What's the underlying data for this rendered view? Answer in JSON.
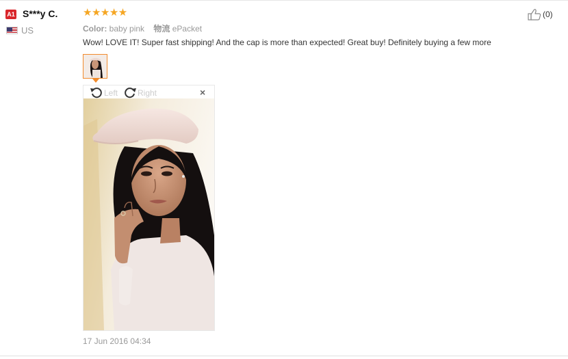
{
  "reviewer": {
    "badge": "A1",
    "name": "S***y C.",
    "country": "US",
    "flag_icon": "us-flag-icon"
  },
  "rating": {
    "stars_text": "★★★★★",
    "value": 5,
    "max": 5,
    "color": "#f5a623"
  },
  "attributes": {
    "color_label": "Color:",
    "color_value": "baby pink",
    "shipping_label": "物流",
    "shipping_value": "ePacket"
  },
  "review_text": "Wow! LOVE IT! Super fast shipping! And the cap is more than expected! Great buy! Definitely buying a few more",
  "helpful": {
    "icon": "thumbs-up-icon",
    "count": "(0)"
  },
  "image_viewer": {
    "rotate_left_label": "Left",
    "rotate_right_label": "Right",
    "close_label": "×"
  },
  "timestamp": "17 Jun 2016 04:34",
  "colors": {
    "accent": "#f28b2c",
    "badge": "#d9262b",
    "muted": "#999999"
  }
}
